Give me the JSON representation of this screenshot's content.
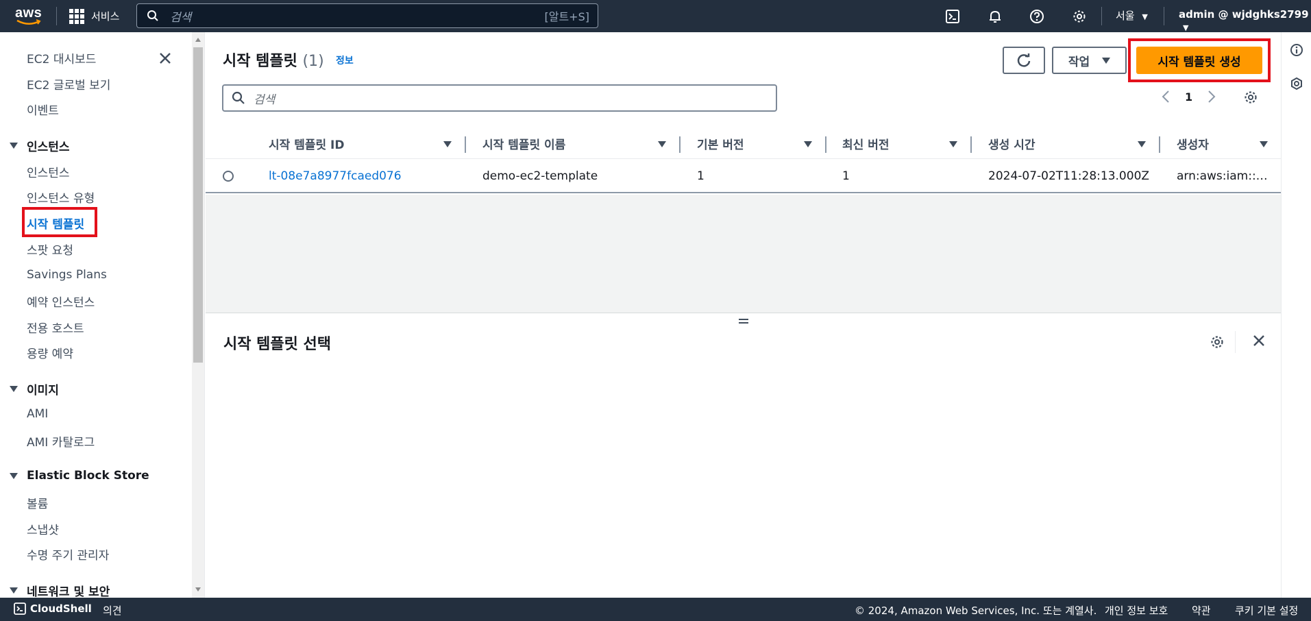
{
  "topnav": {
    "logo": "aws",
    "services_label": "서비스",
    "search_placeholder": "검색",
    "search_shortcut": "[알트+S]",
    "region": "서울",
    "account": "admin @ wjdghks2799"
  },
  "sidebar": {
    "items_top": [
      "EC2 대시보드",
      "EC2 글로벌 보기",
      "이벤트"
    ],
    "sections": [
      {
        "title": "인스턴스",
        "items": [
          "인스턴스",
          "인스턴스 유형",
          "시작 템플릿",
          "스팟 요청",
          "Savings Plans",
          "예약 인스턴스",
          "전용 호스트",
          "용량 예약"
        ]
      },
      {
        "title": "이미지",
        "items": [
          "AMI",
          "AMI 카탈로그"
        ]
      },
      {
        "title": "Elastic Block Store",
        "items": [
          "볼륨",
          "스냅샷",
          "수명 주기 관리자"
        ]
      },
      {
        "title": "네트워크 및 보안",
        "items": []
      }
    ],
    "active_item": "시작 템플릿"
  },
  "main": {
    "title": "시작 템플릿",
    "count": "(1)",
    "info_link": "정보",
    "actions_label": "작업",
    "create_label": "시작 템플릿 생성",
    "search_placeholder": "검색",
    "page_number": "1",
    "columns": [
      "시작 템플릿 ID",
      "시작 템플릿 이름",
      "기본 버전",
      "최신 버전",
      "생성 시간",
      "생성자"
    ],
    "rows": [
      {
        "id": "lt-08e7a8977fcaed076",
        "name": "demo-ec2-template",
        "default_version": "1",
        "latest_version": "1",
        "created": "2024-07-02T11:28:13.000Z",
        "creator": "arn:aws:iam::…"
      }
    ],
    "detail_title": "시작 템플릿 선택"
  },
  "footer": {
    "cloudshell": "CloudShell",
    "feedback": "의견",
    "copyright": "© 2024, Amazon Web Services, Inc. 또는 계열사.",
    "privacy": "개인 정보 보호",
    "terms": "약관",
    "cookies": "쿠키 기본 설정"
  },
  "colors": {
    "nav_bg": "#232f3e",
    "accent_orange": "#ff9900",
    "link_blue": "#0972d3",
    "highlight_red": "#e3111b"
  }
}
